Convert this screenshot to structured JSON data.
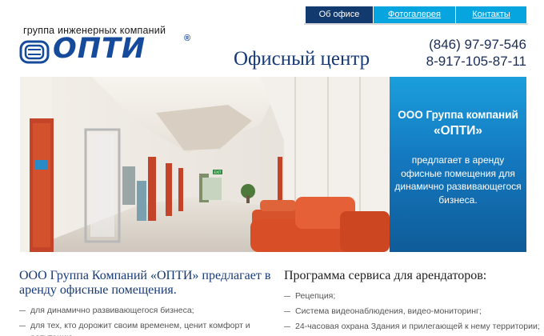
{
  "nav": {
    "tabs": [
      {
        "label": "Об офисе"
      },
      {
        "label": "Фотогалерея"
      },
      {
        "label": "Контакты"
      }
    ]
  },
  "header": {
    "logo_tagline": "группа инженерных компаний",
    "logo_word": "ОПТИ",
    "logo_reg": "®",
    "site_title": "Офисный центр",
    "phone_1": "(846) 97-97-546",
    "phone_2": "8-917-105-87-11"
  },
  "hero": {
    "panel_title": "ООО Группа компаний",
    "panel_brand": "«ОПТИ»",
    "panel_text": "предлагает в аренду офисные помещения для динамично развивающегося бизнеса.",
    "exit_sign": "EXIT"
  },
  "left_column": {
    "title": "ООО Группа Компаний «ОПТИ» предлагает в аренду офисные помещения.",
    "items": [
      "для динамично развивающегося бизнеса;",
      "для тех, кто дорожит своим временем, ценит комфорт и репутацию."
    ]
  },
  "right_column": {
    "title": "Программа сервиса для арендаторов:",
    "items": [
      "Рецепция;",
      "Система видеонаблюдения, видео-мониторинг;",
      "24-часовая охрана Здания и прилегающей к нему территории;"
    ]
  },
  "colors": {
    "nav_active": "#123a6e",
    "nav_link": "#07a5df",
    "brand_blue": "#164b9c",
    "title_blue": "#163a78",
    "panel_blue": "#1479c0"
  }
}
